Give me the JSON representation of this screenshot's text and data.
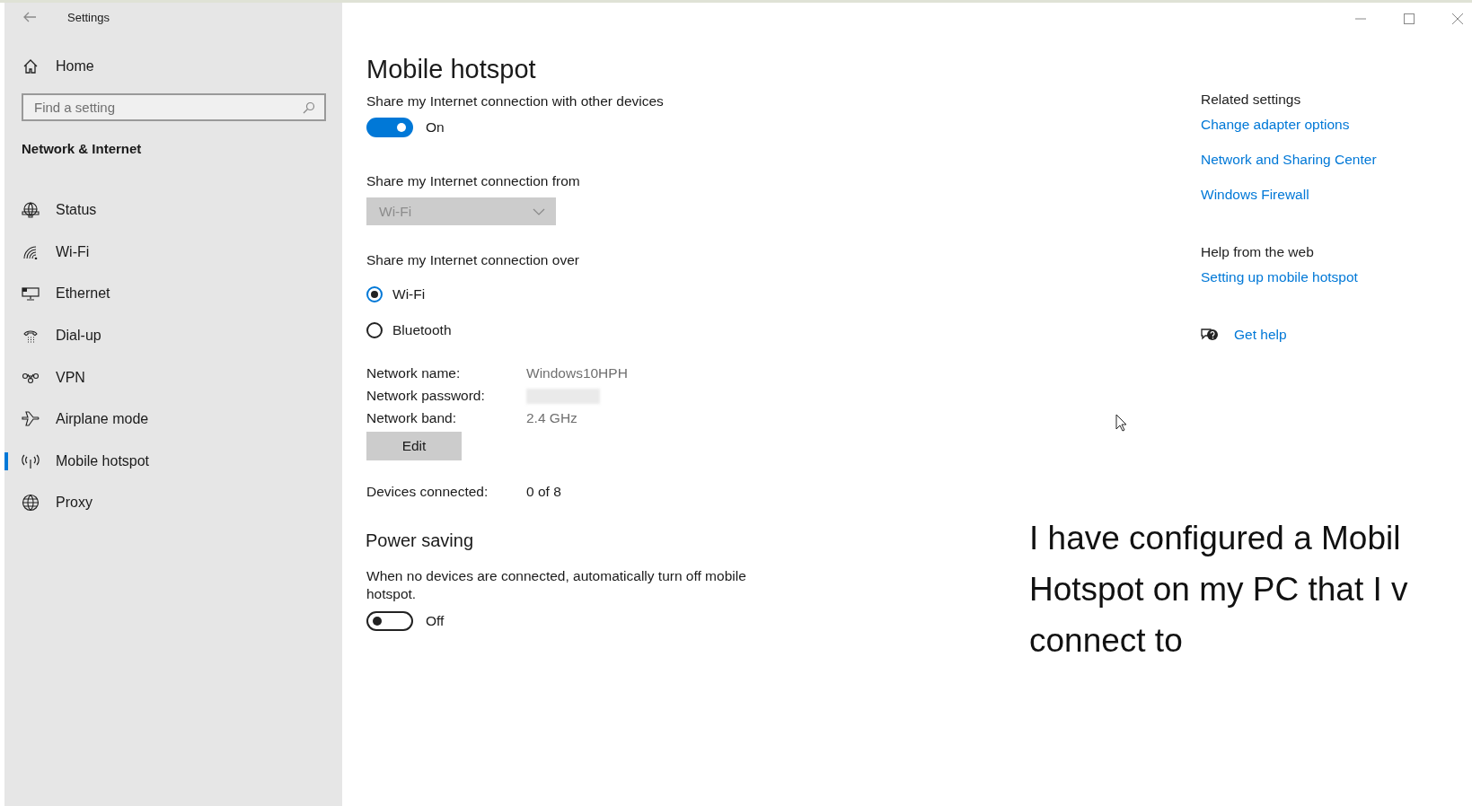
{
  "window": {
    "title": "Settings"
  },
  "sidebar": {
    "home": "Home",
    "search": {
      "placeholder": "Find a setting"
    },
    "section": "Network & Internet",
    "items": [
      {
        "label": "Status",
        "kind": "status",
        "selected": false
      },
      {
        "label": "Wi-Fi",
        "kind": "wifi",
        "selected": false
      },
      {
        "label": "Ethernet",
        "kind": "ethernet",
        "selected": false
      },
      {
        "label": "Dial-up",
        "kind": "dialup",
        "selected": false
      },
      {
        "label": "VPN",
        "kind": "vpn",
        "selected": false
      },
      {
        "label": "Airplane mode",
        "kind": "airplane",
        "selected": false
      },
      {
        "label": "Mobile hotspot",
        "kind": "hotspot",
        "selected": true
      },
      {
        "label": "Proxy",
        "kind": "proxy",
        "selected": false
      }
    ]
  },
  "page": {
    "title": "Mobile hotspot",
    "share": {
      "label": "Share my Internet connection with other devices",
      "on": true,
      "state_label": "On"
    },
    "share_from": {
      "label": "Share my Internet connection from",
      "value": "Wi-Fi",
      "disabled": true
    },
    "share_over": {
      "label": "Share my Internet connection over",
      "options": [
        {
          "label": "Wi-Fi",
          "selected": true
        },
        {
          "label": "Bluetooth",
          "selected": false
        }
      ]
    },
    "details": [
      {
        "label": "Network name:",
        "kind": "text",
        "value": "Windows10HPH"
      },
      {
        "label": "Network password:",
        "kind": "hidden"
      },
      {
        "label": "Network band:",
        "kind": "text",
        "value": "2.4 GHz"
      }
    ],
    "edit_button": "Edit",
    "devices": {
      "label": "Devices connected:",
      "value": "0 of 8"
    },
    "power_saving": {
      "title": "Power saving",
      "description": "When no devices are connected, automatically turn off mobile hotspot.",
      "on": false,
      "state_label": "Off"
    }
  },
  "related": {
    "title": "Related settings",
    "links": [
      "Change adapter options",
      "Network and Sharing Center",
      "Windows Firewall"
    ]
  },
  "help": {
    "title": "Help from the web",
    "links": [
      "Setting up mobile hotspot"
    ],
    "get_help": "Get help"
  },
  "annotation": {
    "lines": [
      "I have configured a Mobil",
      "Hotspot on my PC that I v",
      "connect to"
    ]
  }
}
